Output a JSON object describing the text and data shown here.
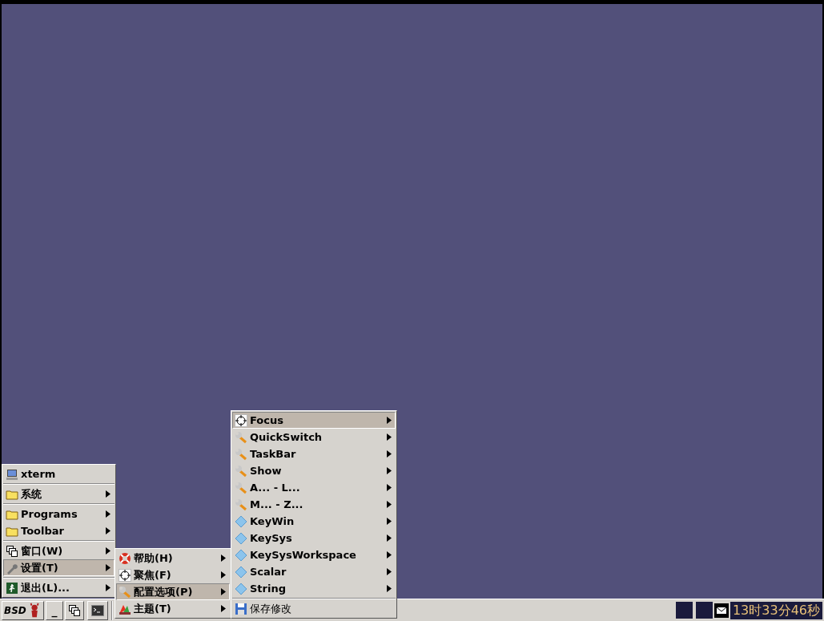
{
  "menus": [
    {
      "items": [
        {
          "kind": "monitor",
          "label": "xterm",
          "submenu": false,
          "selected": false
        },
        {
          "kind": "separator"
        },
        {
          "kind": "folder",
          "label": "系统",
          "submenu": true,
          "selected": false
        },
        {
          "kind": "separator"
        },
        {
          "kind": "folder",
          "label": "Programs",
          "submenu": true,
          "selected": false
        },
        {
          "kind": "folder",
          "label": "Toolbar",
          "submenu": true,
          "selected": false
        },
        {
          "kind": "separator"
        },
        {
          "kind": "windows",
          "label": "窗口(W)",
          "submenu": true,
          "selected": false
        },
        {
          "kind": "tool",
          "label": "设置(T)",
          "submenu": true,
          "selected": true
        },
        {
          "kind": "separator"
        },
        {
          "kind": "exit",
          "label": "退出(L)...",
          "submenu": true,
          "selected": false
        }
      ]
    },
    {
      "items": [
        {
          "kind": "help",
          "label": "帮助(H)",
          "submenu": true,
          "selected": false
        },
        {
          "kind": "focus",
          "label": "聚焦(F)",
          "submenu": true,
          "selected": false
        },
        {
          "kind": "wrench",
          "label": "配置选项(P)",
          "submenu": true,
          "selected": true
        },
        {
          "kind": "theme",
          "label": "主题(T)",
          "submenu": true,
          "selected": false
        }
      ]
    },
    {
      "items": [
        {
          "kind": "focus",
          "label": "Focus",
          "submenu": true,
          "selected": true
        },
        {
          "kind": "wrench",
          "label": "QuickSwitch",
          "submenu": true,
          "selected": false
        },
        {
          "kind": "wrench",
          "label": "TaskBar",
          "submenu": true,
          "selected": false
        },
        {
          "kind": "wrench",
          "label": "Show",
          "submenu": true,
          "selected": false
        },
        {
          "kind": "wrench",
          "label": "A... - L...",
          "submenu": true,
          "selected": false
        },
        {
          "kind": "wrench",
          "label": "M... - Z...",
          "submenu": true,
          "selected": false
        },
        {
          "kind": "diamond",
          "label": "KeyWin",
          "submenu": true,
          "selected": false
        },
        {
          "kind": "diamond",
          "label": "KeySys",
          "submenu": true,
          "selected": false
        },
        {
          "kind": "diamond",
          "label": "KeySysWorkspace",
          "submenu": true,
          "selected": false
        },
        {
          "kind": "diamond",
          "label": "Scalar",
          "submenu": true,
          "selected": false
        },
        {
          "kind": "diamond",
          "label": "String",
          "submenu": true,
          "selected": false
        },
        {
          "kind": "separator"
        },
        {
          "kind": "save",
          "label": "保存修改",
          "submenu": false,
          "selected": false
        }
      ]
    }
  ],
  "taskbar": {
    "start_label": "BSD",
    "minimize_label": "_",
    "clock": "13时33分46秒"
  }
}
